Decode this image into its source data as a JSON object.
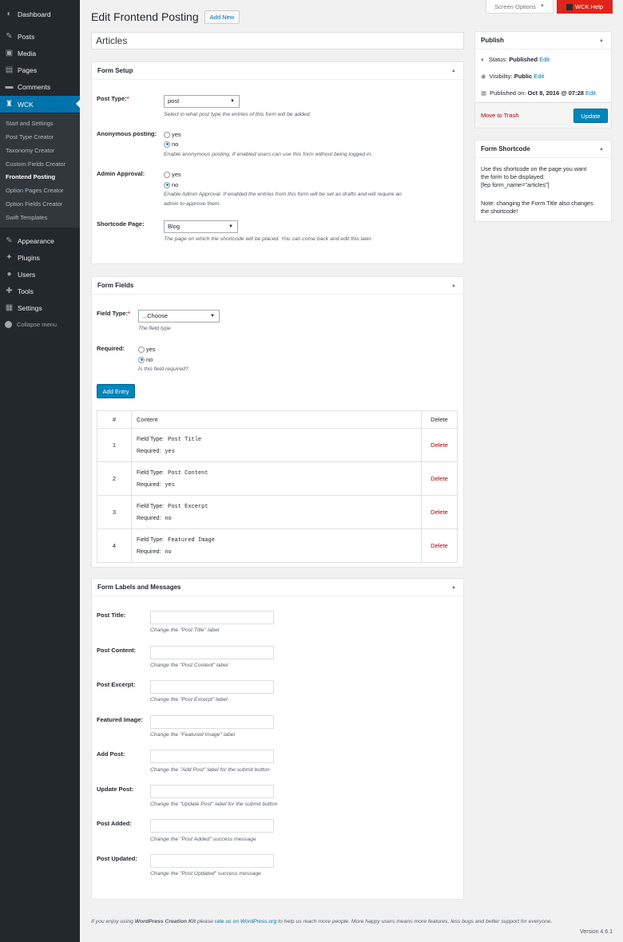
{
  "sidebar": {
    "items": [
      {
        "label": "Dashboard",
        "icon": "dashboard-icon",
        "glyph": "◐"
      },
      {
        "label": "Posts",
        "icon": "pin-icon",
        "glyph": "✎"
      },
      {
        "label": "Media",
        "icon": "media-icon",
        "glyph": "▣"
      },
      {
        "label": "Pages",
        "icon": "pages-icon",
        "glyph": "▤"
      },
      {
        "label": "Comments",
        "icon": "comment-icon",
        "glyph": "▬"
      },
      {
        "label": "WCK",
        "icon": "wck-icon",
        "glyph": "♜"
      },
      {
        "label": "Appearance",
        "icon": "brush-icon",
        "glyph": "✎"
      },
      {
        "label": "Plugins",
        "icon": "plug-icon",
        "glyph": "✦"
      },
      {
        "label": "Users",
        "icon": "user-icon",
        "glyph": "●"
      },
      {
        "label": "Tools",
        "icon": "wrench-icon",
        "glyph": "✚"
      },
      {
        "label": "Settings",
        "icon": "settings-icon",
        "glyph": "▦"
      }
    ],
    "submenu": [
      "Start and Settings",
      "Post Type Creator",
      "Taxonomy Creator",
      "Custom Fields Creator",
      "Frontend Posting",
      "Option Pages Creator",
      "Option Fields Creator",
      "Swift Templates"
    ],
    "collapse": "Collapse menu"
  },
  "top": {
    "screen_options": "Screen Options",
    "help": "WCK Help"
  },
  "page": {
    "title": "Edit Frontend Posting",
    "add_new": "Add New",
    "post_title": "Articles"
  },
  "form_setup": {
    "title": "Form Setup",
    "post_type_label": "Post Type:",
    "post_type_value": "post",
    "post_type_desc": "Select in what post type the entries of this form will be added.",
    "anon_label": "Anonymous posting:",
    "yes": "yes",
    "no": "no",
    "anon_desc": "Enable anonymous posting. If enabled users can use this form without being logged in.",
    "approval_label": "Admin Approval:",
    "approval_desc_1": "Enable Admin Approval. If enabled the entries from this form will be set as drafts and will require an",
    "approval_desc_2": "admin to approve them.",
    "shortcode_label": "Shortcode Page:",
    "shortcode_value": "Blog",
    "shortcode_desc": "The page on which the shortcode will be placed. You can come back and edit this later."
  },
  "form_fields": {
    "title": "Form Fields",
    "field_type_label": "Field Type:",
    "field_type_value": "...Choose",
    "field_type_desc": "The field type",
    "required_label": "Required:",
    "required_desc": "Is this field required?",
    "add_entry": "Add Entry",
    "table_headers": [
      "#",
      "Content",
      "Delete"
    ],
    "field_type_key": "Field Type:",
    "required_key": "Required:",
    "rows": [
      {
        "num": "1",
        "type": "Post Title",
        "required": "yes",
        "action": "Delete"
      },
      {
        "num": "2",
        "type": "Post Content",
        "required": "yes",
        "action": "Delete"
      },
      {
        "num": "3",
        "type": "Post Excerpt",
        "required": "no",
        "action": "Delete"
      },
      {
        "num": "4",
        "type": "Featured Image",
        "required": "no",
        "action": "Delete"
      }
    ]
  },
  "labels_messages": {
    "title": "Form Labels and Messages",
    "fields": [
      {
        "label": "Post Title:",
        "desc": "Change the \"Post Title\" label"
      },
      {
        "label": "Post Content:",
        "desc": "Change the \"Post Content\" label"
      },
      {
        "label": "Post Excerpt:",
        "desc": "Change the \"Post Excerpt\" label"
      },
      {
        "label": "Featured Image:",
        "desc": "Change the \"Featured Image\" label"
      },
      {
        "label": "Add Post:",
        "desc": "Change the \"Add Post\" label for the submit button"
      },
      {
        "label": "Update Post:",
        "desc": "Change the \"Update Post\" label for the submit button"
      },
      {
        "label": "Post Added:",
        "desc": "Change the \"Post Added\" success message"
      },
      {
        "label": "Post Updated:",
        "desc": "Change the \"Post Updated\" success message"
      }
    ]
  },
  "publish": {
    "title": "Publish",
    "status_label": "Status:",
    "status_value": "Published",
    "visibility_label": "Visibility:",
    "visibility_value": "Public",
    "published_label": "Published on:",
    "published_value": "Oct 8, 2016 @ 07:28",
    "edit": "Edit",
    "trash": "Move to Trash",
    "update": "Update"
  },
  "shortcode_box": {
    "title": "Form Shortcode",
    "line1": "Use this shortcode on the page you want",
    "line2": "the form to be displayed:",
    "code": "[fep form_name=\"articles\"]",
    "note1": "Note: changing the Form Title also changes",
    "note2": "the shortcode!"
  },
  "footer": {
    "pre": "If you enjoy using ",
    "brand": "WordPress Creation Kit",
    "mid": " please ",
    "link": "rate us on WordPress.org",
    "post": " to help us reach more people. More happy users means more features, less bugs and better support for everyone.",
    "version": "Version 4.6.1"
  },
  "colors": {
    "sidebar": "#23282d",
    "accent": "#0073aa",
    "primary_button": "#0085ba",
    "help": "#e2231a",
    "delete": "#aa0000"
  }
}
